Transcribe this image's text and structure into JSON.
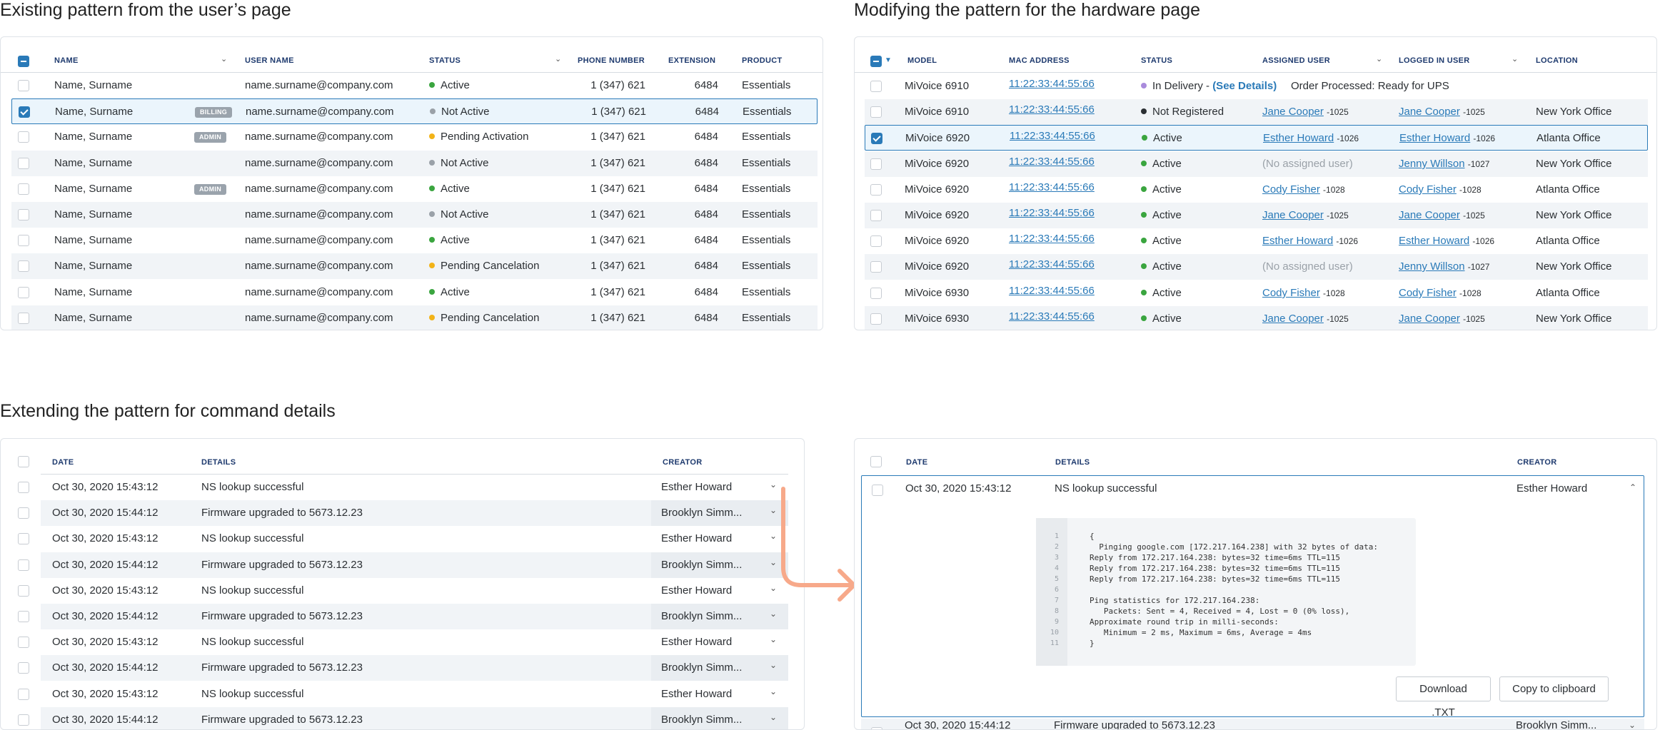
{
  "titles": {
    "existing": "Existing pattern from the user’s page",
    "modifying": "Modifying the pattern for the hardware page",
    "extending": "Extending the pattern for command details"
  },
  "users_table": {
    "headers": {
      "name": "NAME",
      "username": "USER NAME",
      "status": "STATUS",
      "phone": "PHONE NUMBER",
      "extension": "EXTENSION",
      "product": "PRODUCT"
    },
    "rows": [
      {
        "name": "Name, Surname",
        "badge": "",
        "username": "name.surname@company.com",
        "status": "Active",
        "status_color": "#3aa53f",
        "phone": "1 (347) 621",
        "ext": "6484",
        "product": "Essentials",
        "checked": false,
        "selected": false
      },
      {
        "name": "Name, Surname",
        "badge": "BILLING",
        "username": "name.surname@company.com",
        "status": "Not Active",
        "status_color": "#9aa1a8",
        "phone": "1 (347) 621",
        "ext": "6484",
        "product": "Essentials",
        "checked": true,
        "selected": true
      },
      {
        "name": "Name, Surname",
        "badge": "ADMIN",
        "username": "name.surname@company.com",
        "status": "Pending Activation",
        "status_color": "#f2b318",
        "phone": "1 (347) 621",
        "ext": "6484",
        "product": "Essentials",
        "checked": false,
        "selected": false
      },
      {
        "name": "Name, Surname",
        "badge": "",
        "username": "name.surname@company.com",
        "status": "Not Active",
        "status_color": "#9aa1a8",
        "phone": "1 (347) 621",
        "ext": "6484",
        "product": "Essentials",
        "checked": false,
        "selected": false
      },
      {
        "name": "Name, Surname",
        "badge": "ADMIN",
        "username": "name.surname@company.com",
        "status": "Active",
        "status_color": "#3aa53f",
        "phone": "1 (347) 621",
        "ext": "6484",
        "product": "Essentials",
        "checked": false,
        "selected": false
      },
      {
        "name": "Name, Surname",
        "badge": "",
        "username": "name.surname@company.com",
        "status": "Not Active",
        "status_color": "#9aa1a8",
        "phone": "1 (347) 621",
        "ext": "6484",
        "product": "Essentials",
        "checked": false,
        "selected": false
      },
      {
        "name": "Name, Surname",
        "badge": "",
        "username": "name.surname@company.com",
        "status": "Active",
        "status_color": "#3aa53f",
        "phone": "1 (347) 621",
        "ext": "6484",
        "product": "Essentials",
        "checked": false,
        "selected": false
      },
      {
        "name": "Name, Surname",
        "badge": "",
        "username": "name.surname@company.com",
        "status": "Pending Cancelation",
        "status_color": "#f2b318",
        "phone": "1 (347) 621",
        "ext": "6484",
        "product": "Essentials",
        "checked": false,
        "selected": false
      },
      {
        "name": "Name, Surname",
        "badge": "",
        "username": "name.surname@company.com",
        "status": "Active",
        "status_color": "#3aa53f",
        "phone": "1 (347) 621",
        "ext": "6484",
        "product": "Essentials",
        "checked": false,
        "selected": false
      },
      {
        "name": "Name, Surname",
        "badge": "",
        "username": "name.surname@company.com",
        "status": "Pending Cancelation",
        "status_color": "#f2b318",
        "phone": "1 (347) 621",
        "ext": "6484",
        "product": "Essentials",
        "checked": false,
        "selected": false
      }
    ]
  },
  "hardware_table": {
    "headers": {
      "model": "MODEL",
      "mac": "MAC ADDRESS",
      "status": "STATUS",
      "assigned": "ASSIGNED USER",
      "logged": "LOGGED IN USER",
      "location": "LOCATION"
    },
    "rows": [
      {
        "model": "MiVoice 6910",
        "mac": "11:22:33:44:55:66",
        "status": "In Delivery - ",
        "status_link": "(See Details)",
        "status_color": "#a98bdc",
        "assigned": "",
        "assigned_ext": "",
        "logged": "",
        "logged_ext": "",
        "location": "",
        "note": "Order Processed: Ready for UPS",
        "checked": false,
        "selected": false
      },
      {
        "model": "MiVoice 6910",
        "mac": "11:22:33:44:55:66",
        "status": "Not Registered",
        "status_link": "",
        "status_color": "#2b2f33",
        "assigned": "Jane Cooper",
        "assigned_ext": "-1025",
        "logged": "Jane Cooper",
        "logged_ext": "-1025",
        "location": "New York Office",
        "note": "",
        "checked": false,
        "selected": false
      },
      {
        "model": "MiVoice 6920",
        "mac": "11:22:33:44:55:66",
        "status": "Active",
        "status_link": "",
        "status_color": "#3aa53f",
        "assigned": "Esther Howard",
        "assigned_ext": "-1026",
        "logged": "Esther Howard",
        "logged_ext": "-1026",
        "location": "Atlanta Office",
        "note": "",
        "checked": true,
        "selected": true
      },
      {
        "model": "MiVoice 6920",
        "mac": "11:22:33:44:55:66",
        "status": "Active",
        "status_link": "",
        "status_color": "#3aa53f",
        "assigned": "(No assigned user)",
        "assigned_ext": "",
        "logged": "Jenny Willson",
        "logged_ext": "-1027",
        "location": "New York Office",
        "note": "",
        "checked": false,
        "selected": false
      },
      {
        "model": "MiVoice 6920",
        "mac": "11:22:33:44:55:66",
        "status": "Active",
        "status_link": "",
        "status_color": "#3aa53f",
        "assigned": "Cody Fisher",
        "assigned_ext": "-1028",
        "logged": "Cody Fisher",
        "logged_ext": "-1028",
        "location": "Atlanta Office",
        "note": "",
        "checked": false,
        "selected": false
      },
      {
        "model": "MiVoice 6920",
        "mac": "11:22:33:44:55:66",
        "status": "Active",
        "status_link": "",
        "status_color": "#3aa53f",
        "assigned": "Jane Cooper",
        "assigned_ext": "-1025",
        "logged": "Jane Cooper",
        "logged_ext": "-1025",
        "location": "New York Office",
        "note": "",
        "checked": false,
        "selected": false
      },
      {
        "model": "MiVoice 6920",
        "mac": "11:22:33:44:55:66",
        "status": "Active",
        "status_link": "",
        "status_color": "#3aa53f",
        "assigned": "Esther Howard",
        "assigned_ext": "-1026",
        "logged": "Esther Howard",
        "logged_ext": "-1026",
        "location": "Atlanta Office",
        "note": "",
        "checked": false,
        "selected": false
      },
      {
        "model": "MiVoice 6920",
        "mac": "11:22:33:44:55:66",
        "status": "Active",
        "status_link": "",
        "status_color": "#3aa53f",
        "assigned": "(No assigned user)",
        "assigned_ext": "",
        "logged": "Jenny Willson",
        "logged_ext": "-1027",
        "location": "New York Office",
        "note": "",
        "checked": false,
        "selected": false
      },
      {
        "model": "MiVoice 6930",
        "mac": "11:22:33:44:55:66",
        "status": "Active",
        "status_link": "",
        "status_color": "#3aa53f",
        "assigned": "Cody Fisher",
        "assigned_ext": "-1028",
        "logged": "Cody Fisher",
        "logged_ext": "-1028",
        "location": "Atlanta Office",
        "note": "",
        "checked": false,
        "selected": false
      },
      {
        "model": "MiVoice 6930",
        "mac": "11:22:33:44:55:66",
        "status": "Active",
        "status_link": "",
        "status_color": "#3aa53f",
        "assigned": "Jane Cooper",
        "assigned_ext": "-1025",
        "logged": "Jane Cooper",
        "logged_ext": "-1025",
        "location": "New York Office",
        "note": "",
        "checked": false,
        "selected": false
      }
    ]
  },
  "commands_table": {
    "headers": {
      "date": "DATE",
      "details": "DETAILS",
      "creator": "CREATOR"
    },
    "rows": [
      {
        "date": "Oct 30, 2020 15:43:12",
        "details": "NS lookup successful",
        "creator": "Esther Howard"
      },
      {
        "date": "Oct 30, 2020 15:44:12",
        "details": "Firmware upgraded to 5673.12.23",
        "creator": "Brooklyn Simm..."
      },
      {
        "date": "Oct 30, 2020 15:43:12",
        "details": "NS lookup successful",
        "creator": "Esther Howard"
      },
      {
        "date": "Oct 30, 2020 15:44:12",
        "details": "Firmware upgraded to 5673.12.23",
        "creator": "Brooklyn Simm..."
      },
      {
        "date": "Oct 30, 2020 15:43:12",
        "details": "NS lookup successful",
        "creator": "Esther Howard"
      },
      {
        "date": "Oct 30, 2020 15:44:12",
        "details": "Firmware upgraded to 5673.12.23",
        "creator": "Brooklyn Simm..."
      },
      {
        "date": "Oct 30, 2020 15:43:12",
        "details": "NS lookup successful",
        "creator": "Esther Howard"
      },
      {
        "date": "Oct 30, 2020 15:44:12",
        "details": "Firmware upgraded to 5673.12.23",
        "creator": "Brooklyn Simm..."
      },
      {
        "date": "Oct 30, 2020 15:43:12",
        "details": "NS lookup successful",
        "creator": "Esther Howard"
      },
      {
        "date": "Oct 30, 2020 15:44:12",
        "details": "Firmware upgraded to 5673.12.23",
        "creator": "Brooklyn Simm..."
      }
    ]
  },
  "expanded_table": {
    "headers": {
      "date": "DATE",
      "details": "DETAILS",
      "creator": "CREATOR"
    },
    "expanded_row": {
      "date": "Oct 30, 2020 15:43:12",
      "details": "NS lookup successful",
      "creator": "Esther Howard"
    },
    "code_lines": [
      "{",
      "  Pinging google.com [172.217.164.238] with 32 bytes of data:",
      "Reply from 172.217.164.238: bytes=32 time=6ms TTL=115",
      "Reply from 172.217.164.238: bytes=32 time=6ms TTL=115",
      "Reply from 172.217.164.238: bytes=32 time=6ms TTL=115",
      "",
      "Ping statistics for 172.217.164.238:",
      "   Packets: Sent = 4, Received = 4, Lost = 0 (0% loss),",
      "Approximate round trip in milli-seconds:",
      "   Minimum = 2 ms, Maximum = 6ms, Average = 4ms",
      "}"
    ],
    "line_numbers": [
      "1",
      "2",
      "3",
      "4",
      "5",
      "6",
      "7",
      "8",
      "9",
      "10",
      "11"
    ],
    "download_label": "Download .TXT",
    "copy_label": "Copy to clipboard",
    "next_row": {
      "date": "Oct 30, 2020 15:44:12",
      "details": "Firmware upgraded to 5673.12.23",
      "creator": "Brooklyn Simm..."
    }
  },
  "colors": {
    "accent": "#2a7ab8",
    "arrow": "#f7a98a",
    "header_text": "#1e3a6e",
    "alt_row": "#f1f4f7"
  }
}
